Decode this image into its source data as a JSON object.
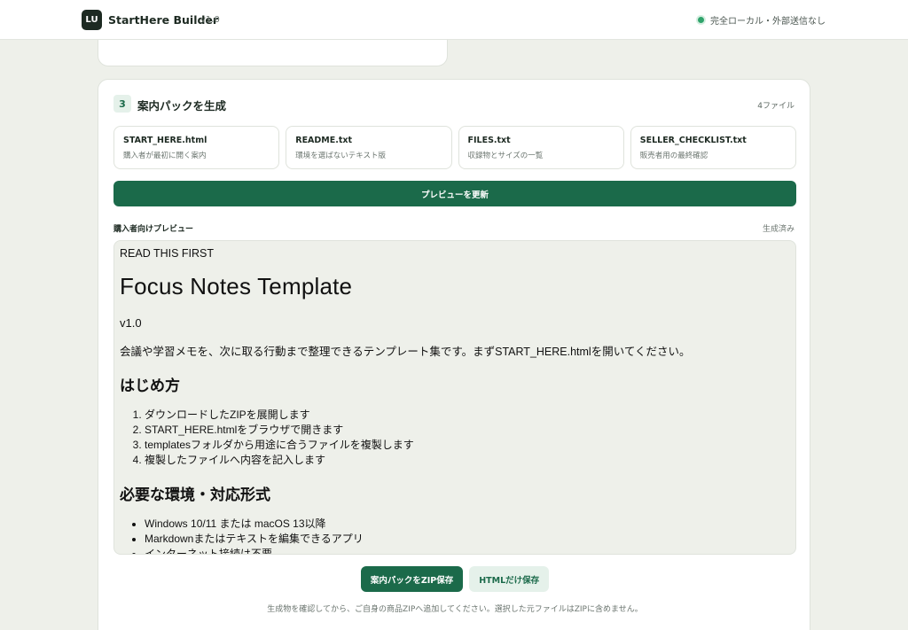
{
  "header": {
    "logo_text": "LU",
    "app_name": "StartHere Builder",
    "version": "v1.0",
    "status_text": "完全ローカル・外部送信なし",
    "status_color": "#2fa36b"
  },
  "step": {
    "number": "3",
    "title": "案内パックを生成",
    "file_count": "4ファイル",
    "files": [
      {
        "name": "START_HERE.html",
        "desc": "購入者が最初に開く案内"
      },
      {
        "name": "README.txt",
        "desc": "環境を選ばないテキスト版"
      },
      {
        "name": "FILES.txt",
        "desc": "収録物とサイズの一覧"
      },
      {
        "name": "SELLER_CHECKLIST.txt",
        "desc": "販売者用の最終確認"
      }
    ],
    "refresh_label": "プレビューを更新",
    "preview_label": "購入者向けプレビュー",
    "preview_status": "生成済み",
    "zip_label": "案内パックをZIP保存",
    "html_label": "HTMLだけ保存",
    "footnote": "生成物を確認してから、ご自身の商品ZIPへ追加してください。選択した元ファイルはZIPに含めません。"
  },
  "preview": {
    "eyebrow": "READ THIS FIRST",
    "title": "Focus Notes Template",
    "version": "v1.0",
    "lead": "会議や学習メモを、次に取る行動まで整理できるテンプレート集です。まずSTART_HERE.htmlを開いてください。",
    "section1_title": "はじめ方",
    "steps": [
      "ダウンロードしたZIPを展開します",
      "START_HERE.htmlをブラウザで開きます",
      "templatesフォルダから用途に合うファイルを複製します",
      "複製したファイルへ内容を記入します"
    ],
    "section2_title": "必要な環境・対応形式",
    "requirements": [
      "Windows 10/11 または macOS 13以降",
      "Markdownまたはテキストを編集できるアプリ",
      "インターネット接続は不要"
    ]
  },
  "colors": {
    "accent": "#1b6a4a",
    "accent_soft": "#e5f1ea",
    "background": "#eef0ea"
  }
}
